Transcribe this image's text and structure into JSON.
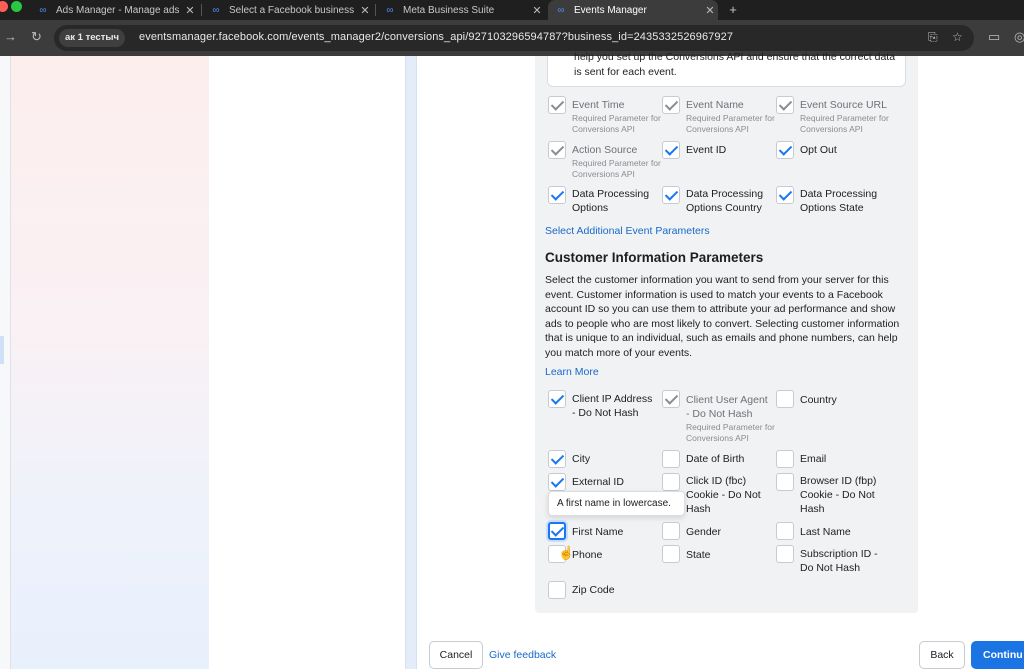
{
  "browser": {
    "tabs": [
      {
        "title": "Ads Manager - Manage ads -",
        "active": false
      },
      {
        "title": "Select a Facebook business",
        "active": false
      },
      {
        "title": "Meta Business Suite",
        "active": false
      },
      {
        "title": "Events Manager",
        "active": true
      }
    ],
    "site_chip": "ак 1 тестыч",
    "url": "eventsmanager.facebook.com/events_manager2/conversions_api/927103296594787?business_id=2435332526967927"
  },
  "intro_note": "help you set up the Conversions API and ensure that the correct data is sent for each event.",
  "event_params": [
    {
      "label": "Event Time",
      "sub": "Required Parameter for Conversions API",
      "checked": true,
      "locked": true
    },
    {
      "label": "Event Name",
      "sub": "Required Parameter for Conversions API",
      "checked": true,
      "locked": true
    },
    {
      "label": "Event Source URL",
      "sub": "Required Parameter for Conversions API",
      "checked": true,
      "locked": true
    },
    {
      "label": "Action Source",
      "sub": "Required Parameter for Conversions API",
      "checked": true,
      "locked": true
    },
    {
      "label": "Event ID",
      "checked": true
    },
    {
      "label": "Opt Out",
      "checked": true
    },
    {
      "label": "Data Processing Options",
      "checked": true
    },
    {
      "label": "Data Processing Options Country",
      "checked": true
    },
    {
      "label": "Data Processing Options State",
      "checked": true
    }
  ],
  "select_additional_link": "Select Additional Event Parameters",
  "customer_section": {
    "title": "Customer Information Parameters",
    "description": "Select the customer information you want to send from your server for this event. Customer information is used to match your events to a Facebook account ID so you can use them to attribute your ad performance and show ads to people who are most likely to convert. Selecting customer information that is unique to an individual, such as emails and phone numbers, can help you match more of your events.",
    "learn_more": "Learn More"
  },
  "customer_params": [
    {
      "label": "Client IP Address - Do Not Hash",
      "checked": true
    },
    {
      "label": "Client User Agent - Do Not Hash",
      "sub": "Required Parameter for Conversions API",
      "checked": true,
      "locked": true
    },
    {
      "label": "Country",
      "checked": false
    },
    {
      "label": "City",
      "checked": true
    },
    {
      "label": "Date of Birth",
      "checked": false
    },
    {
      "label": "Email",
      "checked": false
    },
    {
      "label": "External ID",
      "checked": true
    },
    {
      "label": "Click ID (fbc) Cookie - Do Not Hash",
      "checked": false
    },
    {
      "label": "Browser ID (fbp) Cookie - Do Not Hash",
      "checked": false
    },
    {
      "label": "First Name",
      "checked": true,
      "focused": true
    },
    {
      "label": "Gender",
      "checked": false
    },
    {
      "label": "Last Name",
      "checked": false
    },
    {
      "label": "Phone",
      "checked": false
    },
    {
      "label": "State",
      "checked": false
    },
    {
      "label": "Subscription ID - Do Not Hash",
      "checked": false
    },
    {
      "label": "Zip Code",
      "checked": false
    }
  ],
  "tooltip": "A first name in lowercase.",
  "footer": {
    "cancel": "Cancel",
    "give_feedback": "Give feedback",
    "back": "Back",
    "continue": "Continue"
  },
  "colors": {
    "accent": "#1877f2",
    "primary_button": "#1b74e4",
    "link": "#1769c9"
  }
}
